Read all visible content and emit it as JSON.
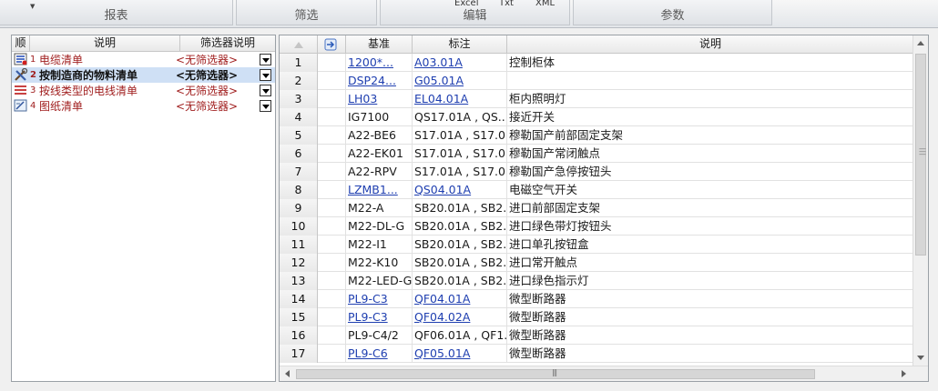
{
  "ribbon": {
    "groups": [
      {
        "label": "报表"
      },
      {
        "label": "筛选"
      },
      {
        "label": "编辑",
        "buttons": [
          "Excel",
          "Txt",
          "XML"
        ]
      },
      {
        "label": "参数"
      }
    ]
  },
  "report_list": {
    "headers": {
      "seq": "顺",
      "desc": "说明",
      "filter": "筛选器说明"
    },
    "rows": [
      {
        "num": "1",
        "desc": "电缆清单",
        "filter": "<无筛选器>",
        "icon": "cable-list-icon",
        "selected": false
      },
      {
        "num": "2",
        "desc": "按制造商的物料清单",
        "filter": "<无筛选器>",
        "icon": "tools-bom-icon",
        "selected": true
      },
      {
        "num": "3",
        "desc": "按线类型的电线清单",
        "filter": "<无筛选器>",
        "icon": "wire-list-icon",
        "selected": false
      },
      {
        "num": "4",
        "desc": "图纸清单",
        "filter": "<无筛选器>",
        "icon": "drawing-list-icon",
        "selected": false
      }
    ]
  },
  "grid": {
    "headers": {
      "base": "基准",
      "mark": "标注",
      "desc": "说明"
    },
    "rows": [
      {
        "no": "1",
        "base": "1200*...",
        "mark": "A03.01A",
        "desc": "控制柜体",
        "link": true
      },
      {
        "no": "2",
        "base": "DSP24...",
        "mark": "G05.01A",
        "desc": "",
        "link": true
      },
      {
        "no": "3",
        "base": "LH03",
        "mark": "EL04.01A",
        "desc": "柜内照明灯",
        "link": true
      },
      {
        "no": "4",
        "base": "IG7100",
        "mark": "QS17.01A , QS...",
        "desc": "接近开关",
        "link": false
      },
      {
        "no": "5",
        "base": "A22-BE6",
        "mark": "S17.01A , S17.0...",
        "desc": "穆勒国产前部固定支架",
        "link": false
      },
      {
        "no": "6",
        "base": "A22-EK01",
        "mark": "S17.01A , S17.0...",
        "desc": "穆勒国产常闭触点",
        "link": false
      },
      {
        "no": "7",
        "base": "A22-RPV",
        "mark": "S17.01A , S17.0...",
        "desc": "穆勒国产急停按钮头",
        "link": false
      },
      {
        "no": "8",
        "base": "LZMB1...",
        "mark": "QS04.01A",
        "desc": "电磁空气开关",
        "link": true
      },
      {
        "no": "9",
        "base": "M22-A",
        "mark": "SB20.01A , SB2...",
        "desc": "进口前部固定支架",
        "link": false
      },
      {
        "no": "10",
        "base": "M22-DL-G",
        "mark": "SB20.01A , SB2...",
        "desc": "进口绿色带灯按钮头",
        "link": false
      },
      {
        "no": "11",
        "base": "M22-I1",
        "mark": "SB20.01A , SB2...",
        "desc": "进口单孔按钮盒",
        "link": false
      },
      {
        "no": "12",
        "base": "M22-K10",
        "mark": "SB20.01A , SB2...",
        "desc": "进口常开触点",
        "link": false
      },
      {
        "no": "13",
        "base": "M22-LED-G",
        "mark": "SB20.01A , SB2...",
        "desc": "进口绿色指示灯",
        "link": false
      },
      {
        "no": "14",
        "base": "PL9-C3",
        "mark": "QF04.01A",
        "desc": "微型断路器",
        "link": true
      },
      {
        "no": "15",
        "base": "PL9-C3",
        "mark": "QF04.02A",
        "desc": "微型断路器",
        "link": true
      },
      {
        "no": "16",
        "base": "PL9-C4/2",
        "mark": "QF06.01A , QF1...",
        "desc": "微型断路器",
        "link": false
      },
      {
        "no": "17",
        "base": "PL9-C6",
        "mark": "QF05.01A",
        "desc": "微型断路器",
        "link": true
      }
    ]
  }
}
